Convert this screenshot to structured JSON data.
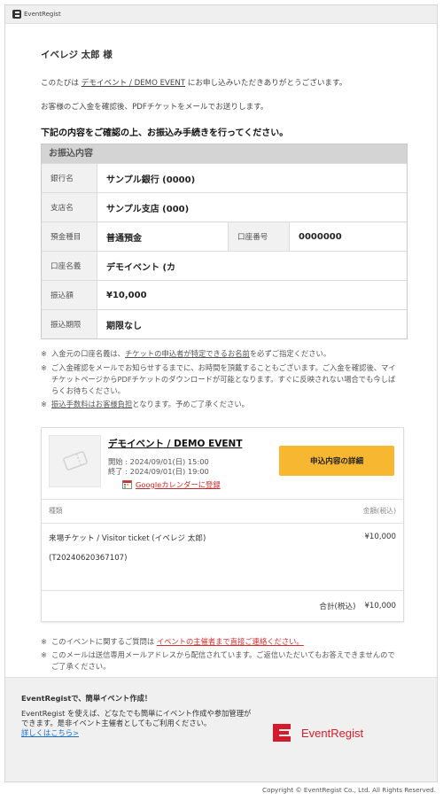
{
  "header": {
    "logo_text": "EventRegist"
  },
  "greeting": "イベレジ 太郎 様",
  "intro": {
    "prefix": "このたびは ",
    "event_link": "デモイベント / DEMO EVENT",
    "suffix": " にお申し込みいただきありがとうございます。"
  },
  "intro2": "お客様のご入金を確認後、PDFチケットをメールでお送りします。",
  "instruction": "下記の内容をご確認の上、お振込み手続きを行ってください。",
  "bank": {
    "title": "お振込内容",
    "bank_name_label": "銀行名",
    "bank_name": "サンプル銀行 (0000)",
    "branch_label": "支店名",
    "branch": "サンプル支店 (000)",
    "type_label": "預金種目",
    "type": "普通預金",
    "account_no_label": "口座番号",
    "account_no": "0000000",
    "holder_label": "口座名義",
    "holder": "デモイベント (カ",
    "amount_label": "振込額",
    "amount": "¥10,000",
    "deadline_label": "振込期限",
    "deadline": "期限なし"
  },
  "notes": {
    "n1_prefix": "入金元の口座名義は、",
    "n1_link": "チケットの申込者が特定できるお名前",
    "n1_suffix": "を必ずご指定ください。",
    "n2": "ご入金確認をメールでお知らせするまでに、お時間を頂戴することもございます。ご入金を確認後、マイチケットページからPDFチケットのダウンロードが可能となります。すぐに反映されない場合でも今しばらくお待ちください。",
    "n3_link": "振込手数料はお客様負担",
    "n3_suffix": "となります。予めご了承ください。",
    "mark": "※"
  },
  "event": {
    "title": "デモイベント / DEMO EVENT",
    "start": "開始 : 2024/09/01(日) 15:00",
    "end": "終了 : 2024/09/01(日) 19:00",
    "gcal": "Googleカレンダーに登録",
    "detail_button": "申込内容の詳細"
  },
  "ticket_table": {
    "col_type": "種類",
    "col_amount": "金額(税込)",
    "item_name": "来場チケット / Visitor ticket (イベレジ 太郎)",
    "item_price": "¥10,000",
    "item_id": "(T20240620367107)",
    "total_label": "合計(税込)",
    "total": "¥10,000"
  },
  "notes2": {
    "q_prefix": "このイベントに関するご質問は ",
    "q_link": "イベントの主催者まで直接ご連絡ください。",
    "sendonly": "このメールは送信専用メールアドレスから配信されています。ご返信いただいてもお答えできませんのでご了承ください。"
  },
  "footer": {
    "title": "EventRegistで、簡単イベント作成！",
    "body": "EventRegist を使えば、どなたでも簡単にイベント作成や参加管理ができます。是非イベント主催者としてもご利用ください。",
    "more": "詳しくはこちら>",
    "brand": "EventRegist"
  },
  "copyright": "Copyright © EventRegist Co., Ltd. All Rights Reserved.",
  "colors": {
    "accent": "#f7b731",
    "brand_red": "#d51b2b",
    "link_red": "#d32f2f"
  }
}
